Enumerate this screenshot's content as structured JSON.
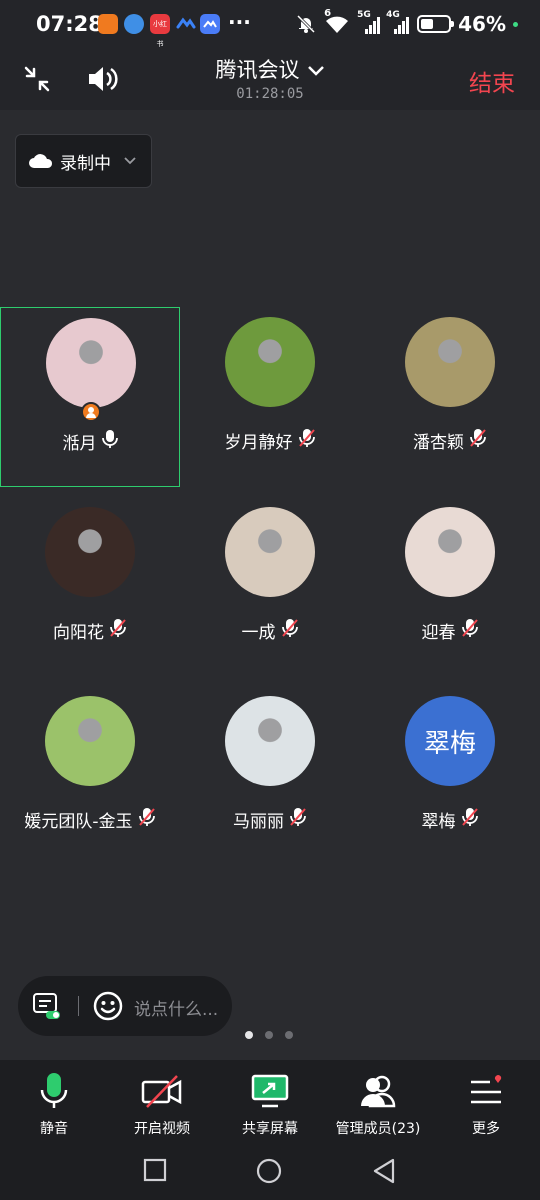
{
  "status_bar": {
    "time": "07:28",
    "battery": "46%",
    "net_5g": "5G",
    "net_4g": "4G",
    "wifi_sub": "6",
    "app_icons": [
      {
        "name": "heart-app-icon",
        "color": "#f07a1f"
      },
      {
        "name": "browser-app-icon",
        "color": "#3f8fe6"
      },
      {
        "name": "xiaohongshu-app-icon",
        "color": "#e83a3f",
        "text": "小红书"
      },
      {
        "name": "tencent-meeting-app-icon",
        "color": "#3b82f6"
      },
      {
        "name": "meeting-app-icon",
        "color": "#4a7cf7"
      }
    ],
    "more": "···"
  },
  "header": {
    "title": "腾讯会议",
    "timer": "01:28:05",
    "end_label": "结束"
  },
  "recording": {
    "label": "录制中"
  },
  "participants": [
    {
      "name": "湉月",
      "muted": false,
      "host": true,
      "active": true,
      "avatar_color": "#e7c9cf"
    },
    {
      "name": "岁月静好",
      "muted": true,
      "avatar_color": "#6e9a3d"
    },
    {
      "name": "潘杏颖",
      "muted": true,
      "avatar_color": "#a89a6a"
    },
    {
      "name": "向阳花",
      "muted": true,
      "avatar_color": "#3a2a26"
    },
    {
      "name": "一成",
      "muted": true,
      "avatar_color": "#d8cbbd"
    },
    {
      "name": "迎春",
      "muted": true,
      "avatar_color": "#e8dad4"
    },
    {
      "name": "媛元团队-金玉",
      "muted": true,
      "avatar_color": "#9bc26a"
    },
    {
      "name": "马丽丽",
      "muted": true,
      "avatar_color": "#dde3e6"
    },
    {
      "name": "翠梅",
      "muted": true,
      "avatar_text": "翠梅",
      "avatar_color": "#3b70d2"
    }
  ],
  "chat": {
    "placeholder": "说点什么..."
  },
  "pager": {
    "pages": 3,
    "current": 1
  },
  "toolbar": {
    "mute": "静音",
    "video": "开启视频",
    "share": "共享屏幕",
    "members": "管理成员(23)",
    "more": "更多"
  },
  "colors": {
    "accent_green": "#2ecc6e",
    "end_red": "#f2454f",
    "share_green": "#1fb86a"
  }
}
